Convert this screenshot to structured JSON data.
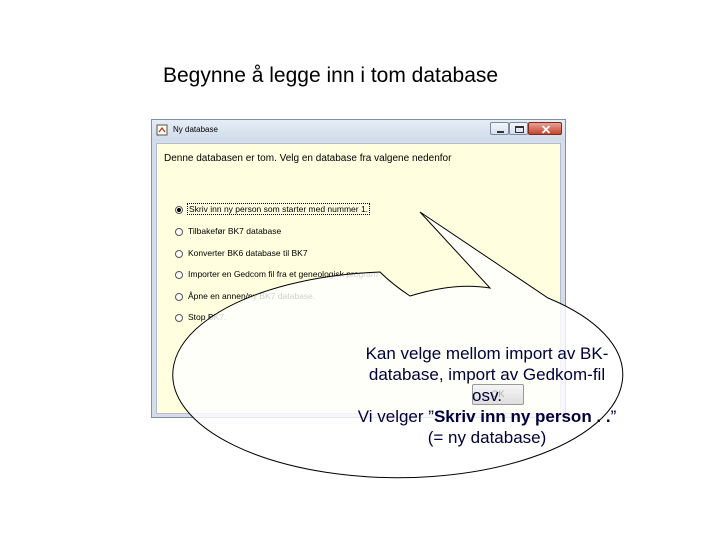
{
  "slide": {
    "title": "Begynne å legge inn i tom database"
  },
  "window": {
    "title": "Ny database",
    "prompt": "Denne databasen er tom.  Velg en database fra valgene nedenfor",
    "options": [
      {
        "label": "Skriv inn ny person som starter med nummer 1.",
        "selected": true
      },
      {
        "label": "Tilbakefør BK7 database",
        "selected": false
      },
      {
        "label": "Konverter BK6 database til BK7",
        "selected": false
      },
      {
        "label": "Importer en Gedcom fil fra et geneologisk program",
        "selected": false
      },
      {
        "label": "Åpne en annen/ny BK7 database.",
        "selected": false
      },
      {
        "label": "Stop BK7.",
        "selected": false
      }
    ],
    "ok_label": "OK"
  },
  "callout": {
    "line1": "Kan velge mellom import av BK-",
    "line2": "database, import av Gedkom-fil",
    "line3": "osv.",
    "line4_prefix": "Vi velger ”",
    "line4_bold": "Skriv inn ny person . .",
    "line4_suffix": "”",
    "line5": "(= ny database)"
  }
}
